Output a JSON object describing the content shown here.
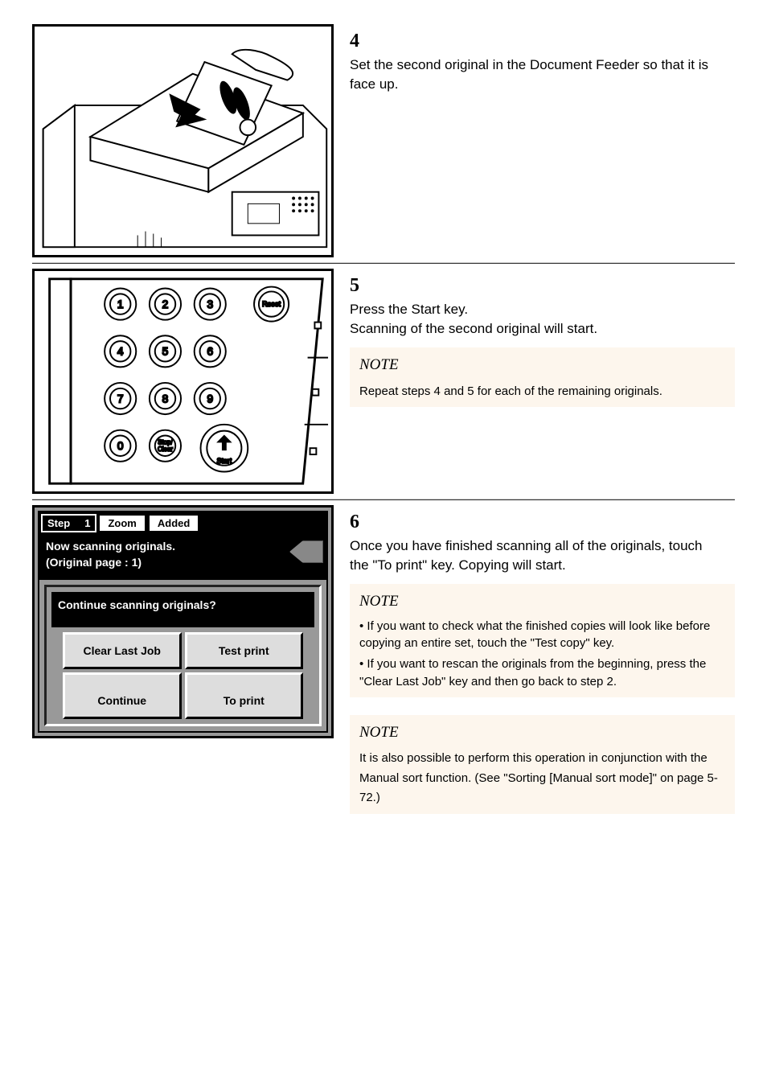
{
  "step4": {
    "num": "4",
    "text": "Set the second original in the Document Feeder so that it is face up."
  },
  "step5": {
    "num": "5",
    "text_line1": "Press the Start key.",
    "text_line2": "Scanning of the second original will start.",
    "note_label": "NOTE",
    "note_text": "Repeat steps 4 and 5 for each of the remaining originals."
  },
  "step6": {
    "num": "6",
    "text": "Once you have finished scanning all of the originals, touch the \"To print\" key. Copying will start.",
    "note1_label": "NOTE",
    "note1_lines": [
      "• If you want to check what the finished copies will look like before copying an entire set, touch the \"Test copy\" key.",
      "• If you want to rescan the originals from the beginning, press the \"Clear Last Job\" key and then go back to step 2."
    ],
    "note2_label": "NOTE",
    "note2_text": "It is also possible to perform this operation in conjunction with the Manual sort function. (See \"Sorting [Manual sort mode]\" on page 5-72.)"
  },
  "screen": {
    "step_label": "Step",
    "step_val": "1",
    "tab_zoom": "Zoom",
    "tab_added": "Added",
    "msg1": "Now scanning originals.",
    "msg2": "(Original page :         1)",
    "prompt": "Continue scanning originals?",
    "btn_clear": "Clear Last Job",
    "btn_test": "Test print",
    "btn_continue": "Continue",
    "btn_print": "To print"
  },
  "keypad": {
    "keys": [
      "1",
      "2",
      "3",
      "4",
      "5",
      "6",
      "7",
      "8",
      "9",
      "0"
    ],
    "reset": "Reset",
    "stopclear": "Stop/\nClear",
    "start": "Start"
  }
}
